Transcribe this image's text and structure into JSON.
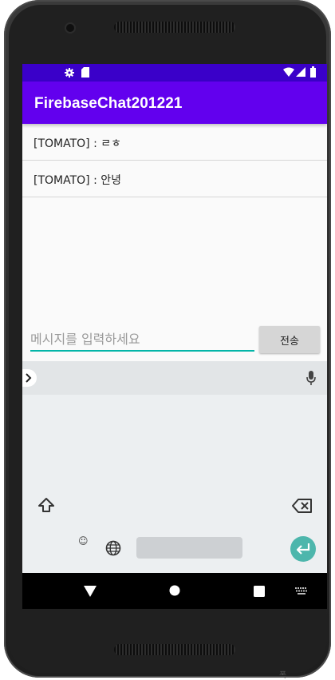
{
  "status_bar": {
    "left_icons": [
      "gear-icon",
      "sd-card-icon"
    ],
    "right_icons": [
      "wifi-icon",
      "signal-icon",
      "battery-icon"
    ]
  },
  "app_bar": {
    "title": "FirebaseChat201221"
  },
  "messages": [
    {
      "text": "[TOMATO] :  ㄹㅎ"
    },
    {
      "text": "[TOMATO] : 안녕"
    }
  ],
  "composer": {
    "placeholder": "메시지를 입력하세요",
    "value": "",
    "send_label": "전송",
    "accent_color": "#03b5a8"
  },
  "keyboard": {
    "icons": [
      "chevron-right-icon",
      "mic-icon",
      "shift-icon",
      "backspace-icon",
      "emoji-icon",
      "globe-icon",
      "enter-icon"
    ]
  },
  "nav_bar": {
    "icons": [
      "back-icon",
      "home-icon",
      "recents-icon",
      "keyboard-switch-icon"
    ]
  },
  "colors": {
    "status_bar": "#3a00c9",
    "app_bar": "#6200ee",
    "enter_key": "#4db6ac"
  },
  "corner_text": "폭"
}
